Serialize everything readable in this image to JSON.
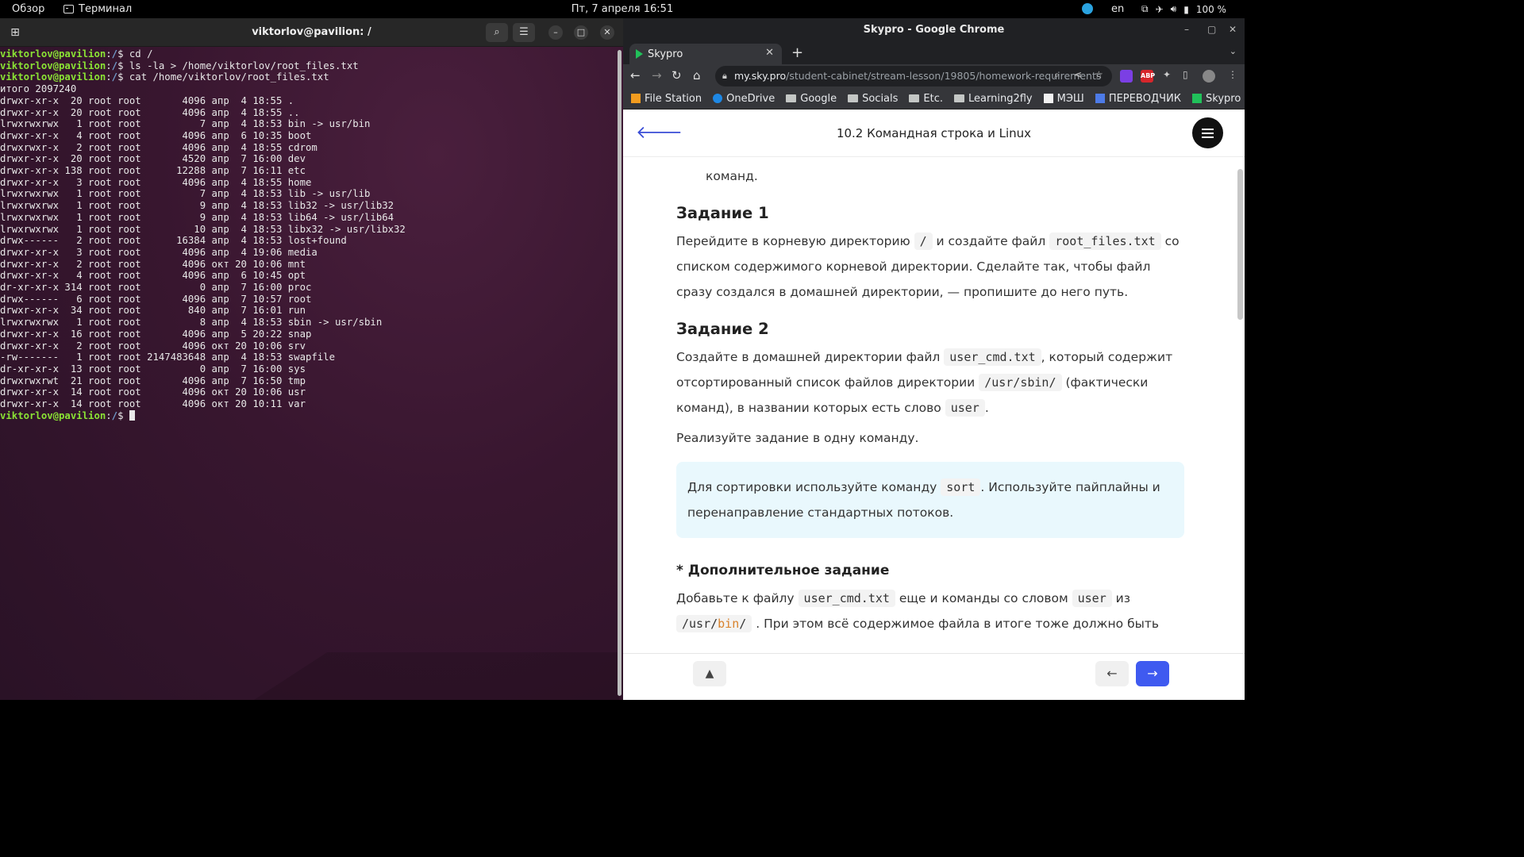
{
  "topbar": {
    "overview": "Обзор",
    "app_name": "Терминал",
    "clock": "Пт, 7 апреля  16:51",
    "lang": "en",
    "battery": "100 %"
  },
  "terminal": {
    "title": "viktorlov@pavilion: /",
    "user_host": "viktorlov@pavilion",
    "cwd": "/",
    "commands": [
      "cd /",
      "ls -la > /home/viktorlov/root_files.txt",
      "cat /home/viktorlov/root_files.txt"
    ],
    "total": "итого 2097240",
    "listing": [
      "drwxr-xr-x  20 root root       4096 апр  4 18:55 .",
      "drwxr-xr-x  20 root root       4096 апр  4 18:55 ..",
      "lrwxrwxrwx   1 root root          7 апр  4 18:53 bin -> usr/bin",
      "drwxr-xr-x   4 root root       4096 апр  6 10:35 boot",
      "drwxrwxr-x   2 root root       4096 апр  4 18:55 cdrom",
      "drwxr-xr-x  20 root root       4520 апр  7 16:00 dev",
      "drwxr-xr-x 138 root root      12288 апр  7 16:11 etc",
      "drwxr-xr-x   3 root root       4096 апр  4 18:55 home",
      "lrwxrwxrwx   1 root root          7 апр  4 18:53 lib -> usr/lib",
      "lrwxrwxrwx   1 root root          9 апр  4 18:53 lib32 -> usr/lib32",
      "lrwxrwxrwx   1 root root          9 апр  4 18:53 lib64 -> usr/lib64",
      "lrwxrwxrwx   1 root root         10 апр  4 18:53 libx32 -> usr/libx32",
      "drwx------   2 root root      16384 апр  4 18:53 lost+found",
      "drwxr-xr-x   3 root root       4096 апр  4 19:06 media",
      "drwxr-xr-x   2 root root       4096 окт 20 10:06 mnt",
      "drwxr-xr-x   4 root root       4096 апр  6 10:45 opt",
      "dr-xr-xr-x 314 root root          0 апр  7 16:00 proc",
      "drwx------   6 root root       4096 апр  7 10:57 root",
      "drwxr-xr-x  34 root root        840 апр  7 16:01 run",
      "lrwxrwxrwx   1 root root          8 апр  4 18:53 sbin -> usr/sbin",
      "drwxr-xr-x  16 root root       4096 апр  5 20:22 snap",
      "drwxr-xr-x   2 root root       4096 окт 20 10:06 srv",
      "-rw-------   1 root root 2147483648 апр  4 18:53 swapfile",
      "dr-xr-xr-x  13 root root          0 апр  7 16:00 sys",
      "drwxrwxrwt  21 root root       4096 апр  7 16:50 tmp",
      "drwxr-xr-x  14 root root       4096 окт 20 10:06 usr",
      "drwxr-xr-x  14 root root       4096 окт 20 10:11 var"
    ]
  },
  "chrome": {
    "window_title": "Skypro - Google Chrome",
    "tab_title": "Skypro",
    "url_host": "my.sky.pro",
    "url_path": "/student-cabinet/stream-lesson/19805/homework-requirements",
    "bookmarks": [
      "File Station",
      "OneDrive",
      "Google",
      "Socials",
      "Etc.",
      "Learning2fly",
      "МЭШ",
      "ПЕРЕВОДЧИК",
      "Skypro DA"
    ]
  },
  "page": {
    "title": "10.2 Командная строка и Linux",
    "fragment": "команд.",
    "task1": {
      "heading": "Задание 1",
      "t1": "Перейдите в корневую директорию",
      "c1": "/",
      "t2": "и создайте файл",
      "c2": "root_files.txt",
      "t3": "со списком содержимого корневой директории. Сделайте так, чтобы файл сразу создался в домашней директории, — пропишите до него путь."
    },
    "task2": {
      "heading": "Задание 2",
      "t1": "Создайте в домашней директории файл",
      "c1": "user_cmd.txt",
      "t2": ", который содержит отсортированный список файлов директории",
      "c2": "/usr/sbin/",
      "t3": "(фактически команд), в названии которых есть слово",
      "c3": "user",
      "t4": ".",
      "p2": "Реализуйте задание в одну команду."
    },
    "tip": {
      "t1": "Для сортировки используйте команду",
      "c1": "sort",
      "t2": ". Используйте пайплайны и перенаправление стандартных потоков."
    },
    "extra": {
      "heading": "* Дополнительное задание",
      "t1": "Добавьте к файлу",
      "c1": "user_cmd.txt",
      "t2": "еще и команды со словом",
      "c2": "user",
      "t3": "из",
      "c3a": "/usr/",
      "c3b": "bin",
      "c3c": "/",
      "t4": ". При этом всё содержимое файла в итоге тоже должно быть"
    }
  }
}
